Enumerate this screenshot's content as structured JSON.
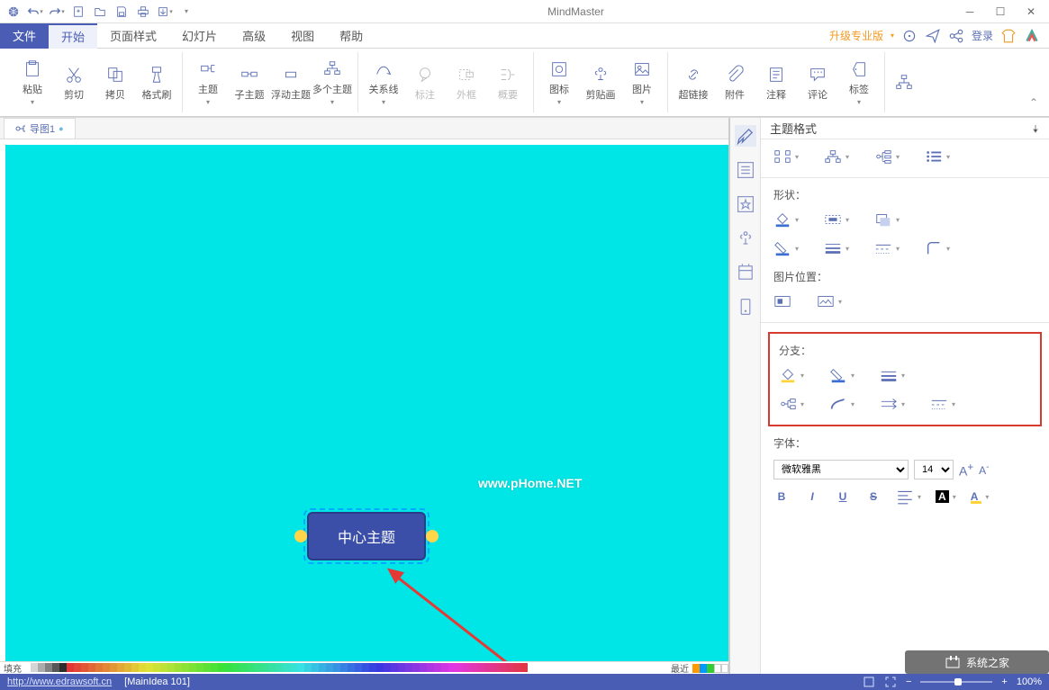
{
  "app": {
    "title": "MindMaster"
  },
  "qat": [
    "globe",
    "undo",
    "redo",
    "new",
    "open",
    "save",
    "print",
    "export",
    "dropdown"
  ],
  "menu": {
    "items": [
      {
        "label": "文件",
        "type": "file"
      },
      {
        "label": "开始",
        "type": "active"
      },
      {
        "label": "页面样式"
      },
      {
        "label": "幻灯片"
      },
      {
        "label": "高级"
      },
      {
        "label": "视图"
      },
      {
        "label": "帮助"
      }
    ],
    "upgrade": "升级专业版",
    "login": "登录"
  },
  "ribbon": [
    {
      "label": "粘贴",
      "icon": "clipboard",
      "dd": true
    },
    {
      "label": "剪切",
      "icon": "scissors"
    },
    {
      "label": "拷贝",
      "icon": "copy"
    },
    {
      "label": "格式刷",
      "icon": "brush"
    },
    {
      "sep": true
    },
    {
      "label": "主题",
      "icon": "topic",
      "dd": true
    },
    {
      "label": "子主题",
      "icon": "subtopic"
    },
    {
      "label": "浮动主题",
      "icon": "float"
    },
    {
      "label": "多个主题",
      "icon": "multi",
      "dd": true
    },
    {
      "sep": true
    },
    {
      "label": "关系线",
      "icon": "relation",
      "dd": true
    },
    {
      "label": "标注",
      "icon": "callout",
      "disabled": true
    },
    {
      "label": "外框",
      "icon": "boundary",
      "disabled": true
    },
    {
      "label": "概要",
      "icon": "summary",
      "disabled": true
    },
    {
      "sep": true
    },
    {
      "label": "图标",
      "icon": "iconset",
      "dd": true
    },
    {
      "label": "剪贴画",
      "icon": "clipart"
    },
    {
      "label": "图片",
      "icon": "picture",
      "dd": true
    },
    {
      "sep": true
    },
    {
      "label": "超链接",
      "icon": "link"
    },
    {
      "label": "附件",
      "icon": "attach"
    },
    {
      "label": "注释",
      "icon": "note"
    },
    {
      "label": "评论",
      "icon": "comment"
    },
    {
      "label": "标签",
      "icon": "tag",
      "dd": true
    },
    {
      "sep": true
    },
    {
      "label": "",
      "icon": "org",
      "small": true
    }
  ],
  "doc": {
    "tab": "导图1"
  },
  "canvas": {
    "central_topic": "中心主题",
    "watermark": "www.pHome.NET"
  },
  "panel": {
    "title": "主题格式",
    "section_shape": "形状：",
    "section_imgpos": "图片位置：",
    "section_branch": "分支：",
    "section_font": "字体：",
    "font_name": "微软雅黑",
    "font_size": "14"
  },
  "palette": {
    "fill_label": "填充",
    "recent_label": "最近"
  },
  "status": {
    "url": "http://www.edrawsoft.cn",
    "info": "[MainIdea 101]",
    "zoom": "100%"
  },
  "corner_wm": "系统之家"
}
